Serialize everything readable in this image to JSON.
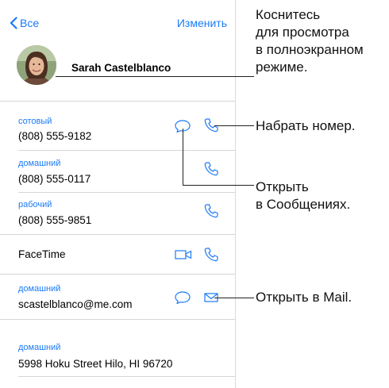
{
  "nav": {
    "back_label": "Все",
    "edit_label": "Изменить"
  },
  "contact": {
    "name": "Sarah Castelblanco"
  },
  "phones": [
    {
      "label": "сотовый",
      "value": "(808) 555-9182"
    },
    {
      "label": "домашний",
      "value": "(808) 555-0117"
    },
    {
      "label": "рабочий",
      "value": "(808) 555-9851"
    }
  ],
  "facetime": {
    "label": "FaceTime"
  },
  "email": {
    "label": "домашний",
    "value": "scastelblanco@me.com"
  },
  "address": {
    "label": "домашний",
    "value": "5998 Hoku Street Hilo, HI 96720"
  },
  "callouts": {
    "photo_line1": "Коснитесь",
    "photo_line2": "для просмотра",
    "photo_line3": "в полноэкранном",
    "photo_line4": "режиме.",
    "call": "Набрать номер.",
    "message_line1": "Открыть",
    "message_line2": "в Сообщениях.",
    "mail": "Открыть в Mail."
  },
  "colors": {
    "accent": "#1a7af8",
    "separator": "#d6d6d6",
    "text": "#000000"
  },
  "icons": [
    "chevron-left-icon",
    "message-bubble-icon",
    "phone-icon",
    "video-camera-icon",
    "envelope-icon"
  ]
}
